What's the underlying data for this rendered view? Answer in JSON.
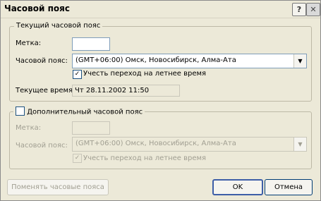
{
  "window": {
    "title": "Часовой пояс",
    "help_label": "?",
    "close_label": "✕"
  },
  "current_tz": {
    "legend": "Текущий часовой пояс",
    "label_field": "Метка:",
    "label_value": "",
    "tz_label": "Часовой пояс:",
    "tz_value": "(GMT+06:00) Омск, Новосибирск, Алма-Ата",
    "dst_label": "Учесть переход на летнее время",
    "dst_checked": "✓",
    "time_label": "Текущее время:",
    "time_value": "Чт 28.11.2002 11:50"
  },
  "additional_tz": {
    "legend": "Дополнительный часовой пояс",
    "enabled_checked": "",
    "label_field": "Метка:",
    "label_value": "",
    "tz_label": "Часовой пояс:",
    "tz_value": "(GMT+06:00) Омск, Новосибирск, Алма-Ата",
    "dst_label": "Учесть переход на летнее время",
    "dst_checked": "✓"
  },
  "buttons": {
    "swap": "Поменять часовые пояса",
    "ok": "OK",
    "cancel": "Отмена"
  }
}
